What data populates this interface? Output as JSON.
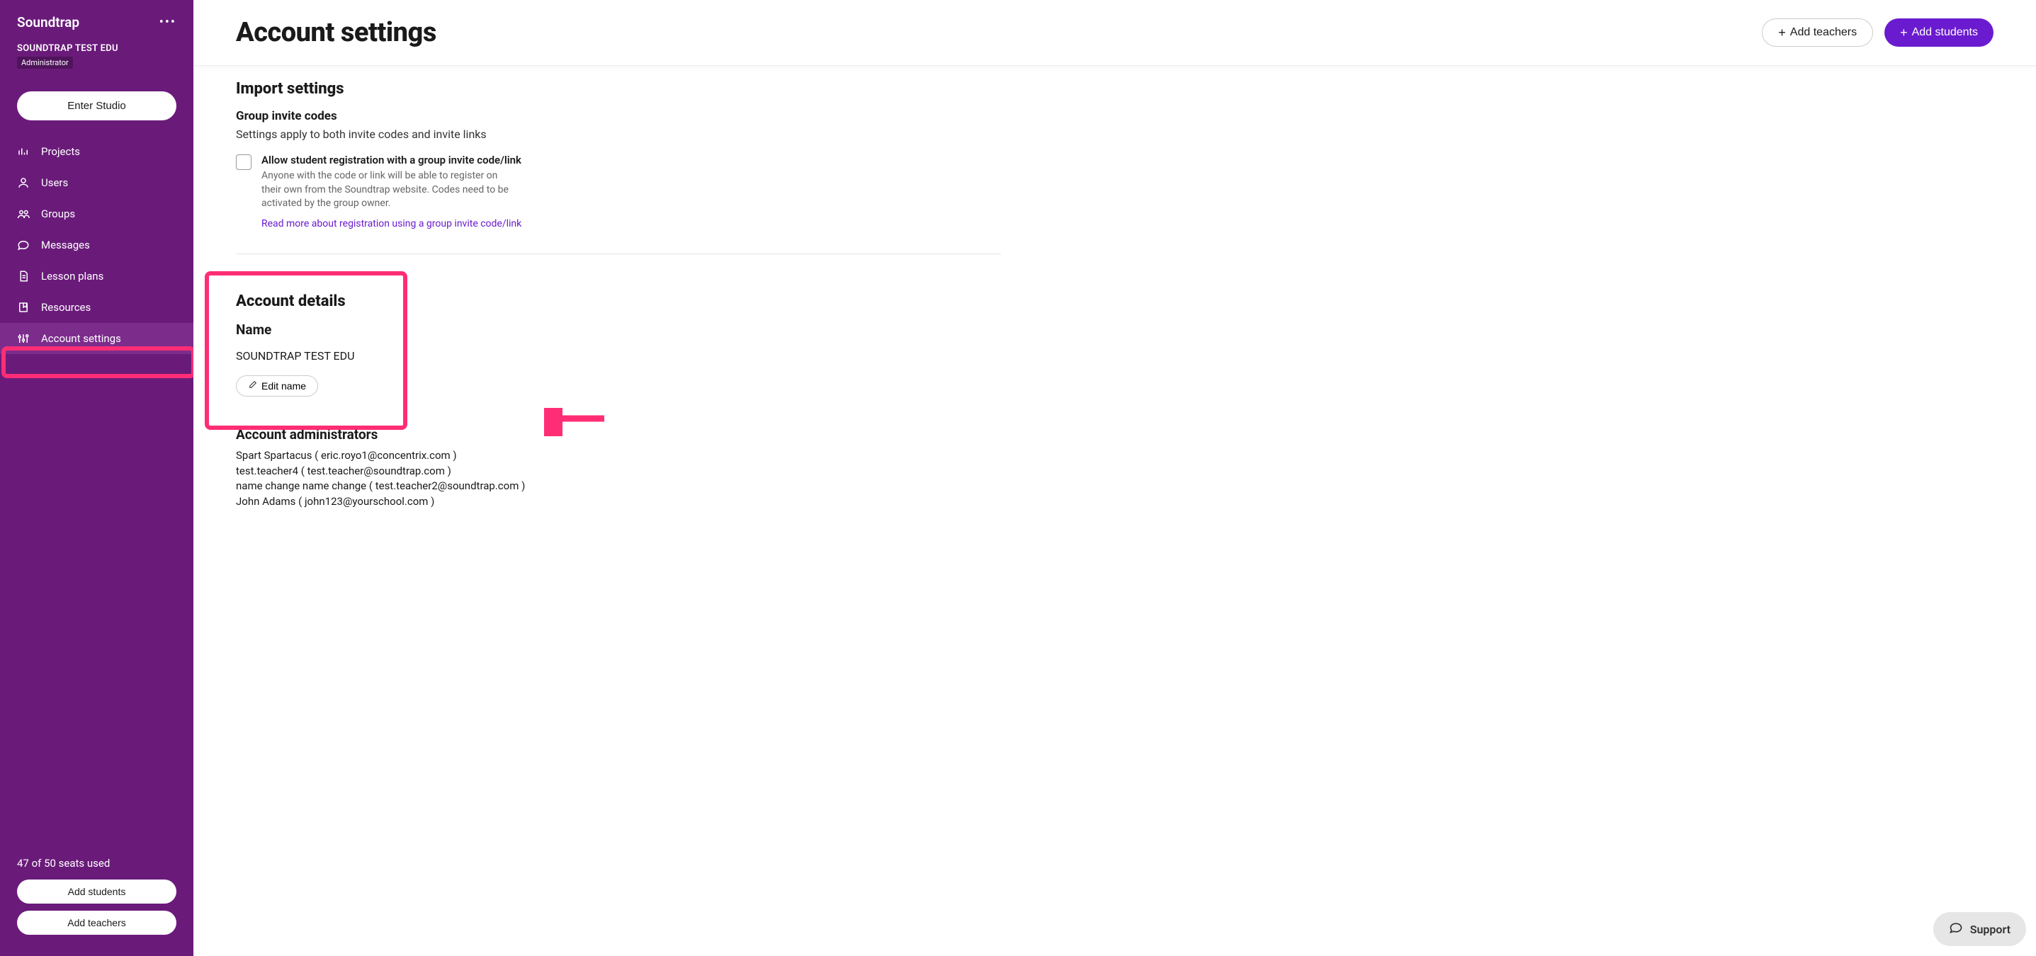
{
  "sidebar": {
    "brand": "Soundtrap",
    "org": "SOUNDTRAP TEST EDU",
    "role": "Administrator",
    "enterStudio": "Enter Studio",
    "nav": [
      {
        "label": "Projects"
      },
      {
        "label": "Users"
      },
      {
        "label": "Groups"
      },
      {
        "label": "Messages"
      },
      {
        "label": "Lesson plans"
      },
      {
        "label": "Resources"
      },
      {
        "label": "Account settings"
      }
    ],
    "seats": "47 of 50 seats used",
    "addStudents": "Add students",
    "addTeachers": "Add teachers"
  },
  "header": {
    "title": "Account settings",
    "addTeachers": "Add teachers",
    "addStudents": "Add students"
  },
  "import": {
    "title": "Import settings",
    "groupTitle": "Group invite codes",
    "desc": "Settings apply to both invite codes and invite links",
    "checkboxLabel": "Allow student registration with a group invite code/link",
    "checkboxHelp": "Anyone with the code or link will be able to register on their own from the Soundtrap website. Codes need to be activated by the group owner.",
    "link": "Read more about registration using a group invite code/link"
  },
  "account": {
    "title": "Account details",
    "nameLabel": "Name",
    "nameValue": "SOUNDTRAP TEST EDU",
    "editName": "Edit name",
    "adminsTitle": "Account administrators",
    "admins": [
      "Spart Spartacus ( eric.royo1@concentrix.com )",
      "test.teacher4 ( test.teacher@soundtrap.com )",
      "name change name change ( test.teacher2@soundtrap.com )",
      "John Adams ( john123@yourschool.com )"
    ]
  },
  "support": "Support"
}
